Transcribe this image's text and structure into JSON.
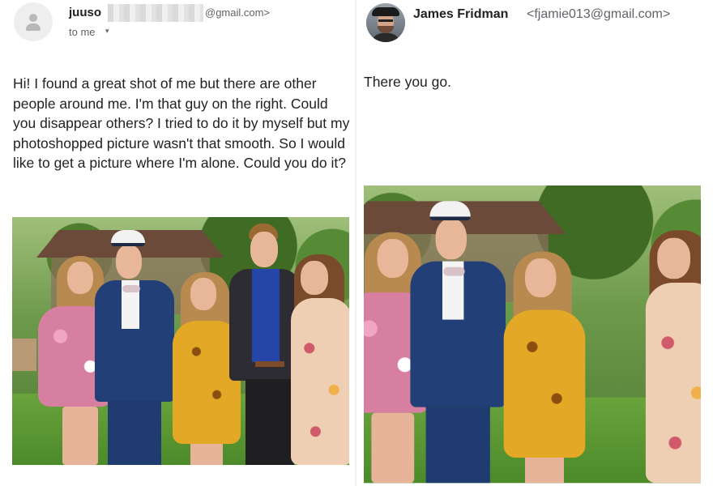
{
  "left_email": {
    "sender_name": "juuso",
    "sender_email_suffix": "@gmail.com>",
    "to_line": "to me",
    "caret": "▾",
    "body": "Hi! I found a great shot of me but there are other people around me. I'm that guy on the right. Could you disappear others? I tried to do it by myself but my photoshopped picture wasn't that smooth. So I would like to get a picture where I'm alone. Could you do it?",
    "avatar_icon": "default-person-icon"
  },
  "right_email": {
    "sender_name": "James Fridman",
    "sender_email": "<fjamie013@gmail.com>",
    "body": "There you go."
  },
  "colors": {
    "name_text": "#202124",
    "meta_text": "#5f6368",
    "body_text": "#222222",
    "divider": "#f1f1f1"
  }
}
